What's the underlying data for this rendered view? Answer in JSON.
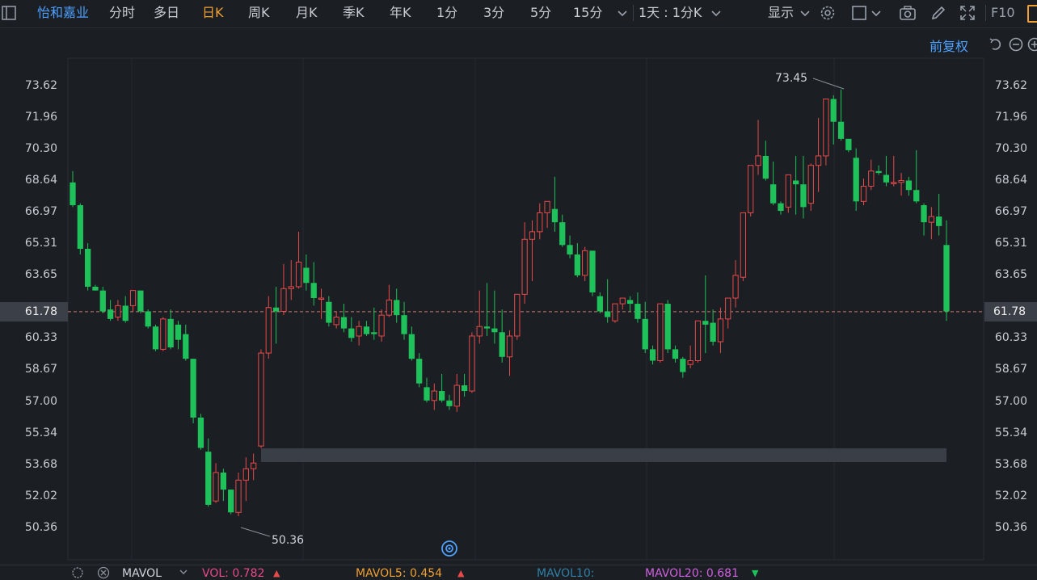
{
  "toolbar": {
    "stock_name": "怡和嘉业",
    "tabs": [
      "分时",
      "多日",
      "日K",
      "周K",
      "月K",
      "季K",
      "年K",
      "1分",
      "3分",
      "5分",
      "15分"
    ],
    "active_tab": "日K",
    "period_select": "1天 : 1分K",
    "display_label": "显示",
    "f10_label": "F10"
  },
  "adjust_label": "前复权",
  "y_axis_labels": [
    "73.62",
    "71.96",
    "70.30",
    "68.64",
    "66.97",
    "65.31",
    "63.65",
    "61.98",
    "60.33",
    "58.67",
    "57.00",
    "55.34",
    "53.68",
    "52.02",
    "50.36"
  ],
  "current_price": "61.78",
  "annotations": {
    "high": "73.45",
    "low": "50.36"
  },
  "bottom_bar": {
    "indicator": "MAVOL",
    "vol": "VOL: 0.782",
    "mavol5": "MAVOL5: 0.454",
    "mavol10": "MAVOL10:",
    "mavol20": "MAVOL20: 0.681"
  },
  "colors": {
    "up": "#e84a4a",
    "down": "#1fc25a",
    "accent": "#f0a030",
    "link": "#4ea1ff"
  },
  "chart_data": {
    "type": "candlestick",
    "ylim": [
      49.5,
      74.5
    ],
    "candles": [
      [
        68.6,
        69.2,
        67.4,
        67.3
      ],
      [
        67.4,
        67.5,
        65.1,
        64.8
      ],
      [
        65.1,
        65.4,
        63.1,
        62.9
      ],
      [
        63.1,
        63.2,
        62.9,
        62.9
      ],
      [
        62.9,
        63.1,
        61.8,
        61.7
      ],
      [
        61.9,
        62.4,
        61.4,
        61.3
      ],
      [
        61.5,
        62.4,
        62.1,
        61.3
      ],
      [
        62.1,
        62.6,
        61.3,
        61.2
      ],
      [
        62.1,
        62.6,
        62.9,
        61.8
      ],
      [
        62.9,
        62.9,
        61.8,
        61.7
      ],
      [
        61.8,
        61.9,
        61.0,
        60.9
      ],
      [
        61.0,
        61.1,
        59.8,
        59.7
      ],
      [
        59.8,
        61.5,
        61.4,
        59.7
      ],
      [
        61.4,
        61.9,
        59.9,
        59.8
      ],
      [
        61.1,
        61.3,
        60.3,
        59.8
      ],
      [
        60.6,
        61.1,
        59.3,
        59.2
      ],
      [
        59.3,
        59.3,
        56.2,
        55.9
      ],
      [
        56.2,
        56.4,
        54.6,
        54.5
      ],
      [
        54.4,
        55.1,
        51.6,
        51.5
      ],
      [
        51.8,
        53.8,
        53.3,
        51.7
      ],
      [
        53.3,
        53.5,
        52.4,
        51.8
      ],
      [
        52.4,
        52.4,
        51.2,
        51.1
      ],
      [
        51.2,
        53.3,
        52.9,
        51.0
      ],
      [
        52.9,
        54.1,
        53.5,
        51.8
      ],
      [
        53.5,
        54.3,
        53.8,
        52.9
      ],
      [
        54.7,
        59.8,
        59.6,
        54.6
      ],
      [
        59.6,
        62.6,
        62.0,
        59.3
      ],
      [
        62.0,
        63.1,
        61.8,
        60.1
      ],
      [
        61.8,
        64.3,
        63.0,
        61.6
      ],
      [
        63.0,
        64.5,
        63.1,
        62.4
      ],
      [
        63.1,
        66.0,
        64.4,
        63.0
      ],
      [
        64.1,
        64.8,
        63.3,
        62.9
      ],
      [
        63.3,
        64.4,
        62.5,
        62.1
      ],
      [
        62.5,
        63.0,
        62.5,
        61.4
      ],
      [
        62.3,
        62.6,
        61.2,
        61.0
      ],
      [
        61.1,
        61.8,
        61.5,
        60.9
      ],
      [
        61.5,
        62.2,
        60.9,
        60.7
      ],
      [
        60.9,
        61.5,
        60.4,
        60.2
      ],
      [
        60.5,
        61.3,
        61.0,
        60.0
      ],
      [
        61.0,
        61.3,
        60.6,
        60.5
      ],
      [
        60.7,
        62.0,
        60.6,
        60.3
      ],
      [
        60.5,
        61.9,
        61.6,
        60.2
      ],
      [
        61.6,
        63.2,
        62.4,
        61.5
      ],
      [
        62.4,
        63.0,
        61.6,
        61.2
      ],
      [
        61.6,
        62.3,
        60.6,
        60.3
      ],
      [
        60.6,
        61.0,
        59.3,
        59.2
      ],
      [
        59.3,
        59.6,
        58.0,
        57.8
      ],
      [
        57.8,
        58.3,
        57.1,
        57.0
      ],
      [
        57.1,
        58.0,
        57.6,
        56.6
      ],
      [
        57.6,
        58.5,
        57.1,
        57.0
      ],
      [
        57.1,
        57.4,
        56.8,
        56.6
      ],
      [
        56.8,
        58.5,
        57.9,
        56.5
      ],
      [
        57.9,
        58.5,
        57.6,
        57.3
      ],
      [
        57.6,
        60.7,
        60.5,
        57.5
      ],
      [
        60.5,
        62.9,
        61.0,
        60.1
      ],
      [
        61.0,
        63.3,
        60.9,
        60.5
      ],
      [
        60.9,
        62.9,
        60.7,
        60.1
      ],
      [
        60.7,
        61.9,
        59.4,
        59.1
      ],
      [
        59.4,
        60.8,
        60.5,
        58.4
      ],
      [
        60.5,
        61.2,
        62.7,
        60.3
      ],
      [
        62.7,
        66.5,
        65.6,
        62.2
      ],
      [
        65.6,
        66.6,
        66.0,
        63.4
      ],
      [
        66.0,
        67.5,
        67.0,
        65.6
      ],
      [
        67.0,
        67.3,
        67.6,
        66.2
      ],
      [
        67.2,
        68.9,
        66.5,
        66.0
      ],
      [
        66.5,
        66.9,
        65.3,
        65.2
      ],
      [
        65.3,
        65.8,
        64.8,
        64.6
      ],
      [
        64.8,
        65.4,
        63.7,
        63.6
      ],
      [
        63.7,
        65.2,
        65.0,
        63.4
      ],
      [
        65.0,
        65.0,
        62.8,
        62.6
      ],
      [
        62.6,
        62.8,
        61.8,
        61.7
      ],
      [
        61.8,
        63.5,
        61.5,
        61.2
      ],
      [
        61.3,
        62.1,
        62.2,
        61.2
      ],
      [
        62.2,
        62.3,
        62.5,
        61.9
      ],
      [
        62.4,
        62.6,
        62.2,
        61.8
      ],
      [
        62.2,
        62.8,
        61.4,
        61.2
      ],
      [
        61.4,
        62.3,
        59.8,
        59.6
      ],
      [
        59.8,
        60.0,
        59.2,
        59.0
      ],
      [
        59.2,
        61.9,
        62.2,
        59.1
      ],
      [
        62.2,
        62.4,
        59.8,
        59.6
      ],
      [
        59.8,
        60.0,
        59.3,
        59.1
      ],
      [
        59.3,
        59.4,
        58.6,
        58.3
      ],
      [
        59.0,
        60.0,
        59.2,
        58.8
      ],
      [
        59.2,
        61.3,
        61.3,
        59.1
      ],
      [
        61.3,
        63.7,
        61.1,
        59.6
      ],
      [
        61.2,
        61.9,
        60.2,
        60.0
      ],
      [
        60.2,
        62.0,
        61.4,
        59.6
      ],
      [
        61.4,
        62.2,
        62.5,
        60.9
      ],
      [
        62.5,
        64.5,
        63.7,
        62.0
      ],
      [
        63.6,
        63.7,
        67.0,
        63.4
      ],
      [
        67.0,
        68.1,
        69.5,
        66.8
      ],
      [
        69.5,
        71.9,
        70.0,
        69.0
      ],
      [
        70.0,
        70.8,
        68.8,
        68.7
      ],
      [
        68.5,
        69.7,
        67.5,
        67.4
      ],
      [
        67.5,
        67.6,
        67.1,
        66.9
      ],
      [
        67.3,
        68.9,
        69.0,
        67.0
      ],
      [
        68.7,
        70.0,
        68.5,
        66.9
      ],
      [
        68.5,
        70.0,
        67.3,
        66.7
      ],
      [
        67.5,
        69.6,
        69.5,
        67.1
      ],
      [
        69.5,
        72.0,
        70.0,
        68.1
      ],
      [
        70.0,
        73.0,
        73.0,
        69.5
      ],
      [
        73.0,
        73.2,
        71.8,
        70.6
      ],
      [
        71.8,
        73.5,
        70.9,
        70.8
      ],
      [
        70.9,
        70.9,
        70.3,
        70.2
      ],
      [
        69.9,
        70.4,
        67.6,
        67.1
      ],
      [
        67.6,
        68.8,
        68.4,
        67.4
      ],
      [
        68.4,
        69.8,
        69.2,
        68.2
      ],
      [
        69.2,
        69.5,
        69.1,
        69.0
      ],
      [
        69.0,
        70.0,
        68.6,
        68.4
      ],
      [
        68.6,
        70.0,
        68.6,
        68.4
      ],
      [
        68.6,
        69.1,
        68.7,
        67.9
      ],
      [
        68.7,
        68.9,
        68.2,
        67.9
      ],
      [
        68.2,
        70.3,
        67.6,
        67.5
      ],
      [
        67.4,
        67.5,
        66.5,
        65.8
      ],
      [
        66.5,
        67.3,
        66.8,
        65.6
      ],
      [
        66.8,
        68.0,
        66.3,
        65.8
      ],
      [
        65.3,
        66.6,
        61.8,
        61.3
      ]
    ]
  }
}
